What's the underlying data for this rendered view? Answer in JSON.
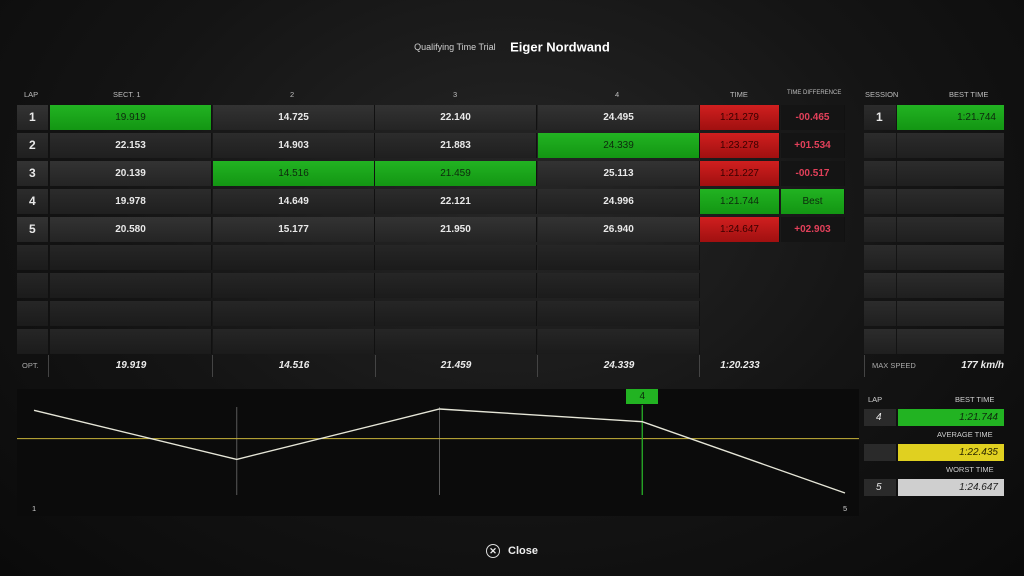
{
  "header": {
    "subtitle": "Qualifying Time Trial",
    "track": "Eiger Nordwand"
  },
  "columns": {
    "lap": "LAP",
    "sect1": "SECT. 1",
    "sect2": "2",
    "sect3": "3",
    "sect4": "4",
    "time": "TIME",
    "diff": "TIME DIFFERENCE",
    "session": "SESSION",
    "best_time": "BEST TIME"
  },
  "laps": [
    {
      "lap": "1",
      "s1": "19.919",
      "s2": "14.725",
      "s3": "22.140",
      "s4": "24.495",
      "time": "1:21.279",
      "diff": "-00.465"
    },
    {
      "lap": "2",
      "s1": "22.153",
      "s2": "14.903",
      "s3": "21.883",
      "s4": "24.339",
      "time": "1:23.278",
      "diff": "+01.534"
    },
    {
      "lap": "3",
      "s1": "20.139",
      "s2": "14.516",
      "s3": "21.459",
      "s4": "25.113",
      "time": "1:21.227",
      "diff": "-00.517"
    },
    {
      "lap": "4",
      "s1": "19.978",
      "s2": "14.649",
      "s3": "22.121",
      "s4": "24.996",
      "time": "1:21.744",
      "diff": "Best"
    },
    {
      "lap": "5",
      "s1": "20.580",
      "s2": "15.177",
      "s3": "21.950",
      "s4": "26.940",
      "time": "1:24.647",
      "diff": "+02.903"
    }
  ],
  "optimal": {
    "label": "OPT.",
    "s1": "19.919",
    "s2": "14.516",
    "s3": "21.459",
    "s4": "24.339",
    "time": "1:20.233"
  },
  "session": {
    "num": "1",
    "best": "1:21.744"
  },
  "max_speed": {
    "label": "MAX SPEED",
    "value": "177 km/h"
  },
  "graph": {
    "x_start": "1",
    "x_end": "5",
    "marker": "4",
    "laps_seconds": [
      81.279,
      83.278,
      81.227,
      81.744,
      84.647
    ],
    "average_seconds": 82.435,
    "colors": {
      "line": "#e6e6d8",
      "avg": "#c8b43a",
      "marker": "#22b322",
      "grid": "#5a5a5a"
    }
  },
  "legend": {
    "lap_label": "LAP",
    "best_label": "BEST TIME",
    "best_lap": "4",
    "best_value": "1:21.744",
    "avg_label": "AVERAGE TIME",
    "avg_value": "1:22.435",
    "worst_label": "WORST TIME",
    "worst_lap": "5",
    "worst_value": "1:24.647"
  },
  "footer": {
    "close_label": "Close"
  },
  "colors": {
    "green": "#22b322",
    "red": "#c81a1a",
    "yellow": "#e0d020",
    "grey": "#cfcfcf",
    "diff_text": "#e3405a"
  }
}
